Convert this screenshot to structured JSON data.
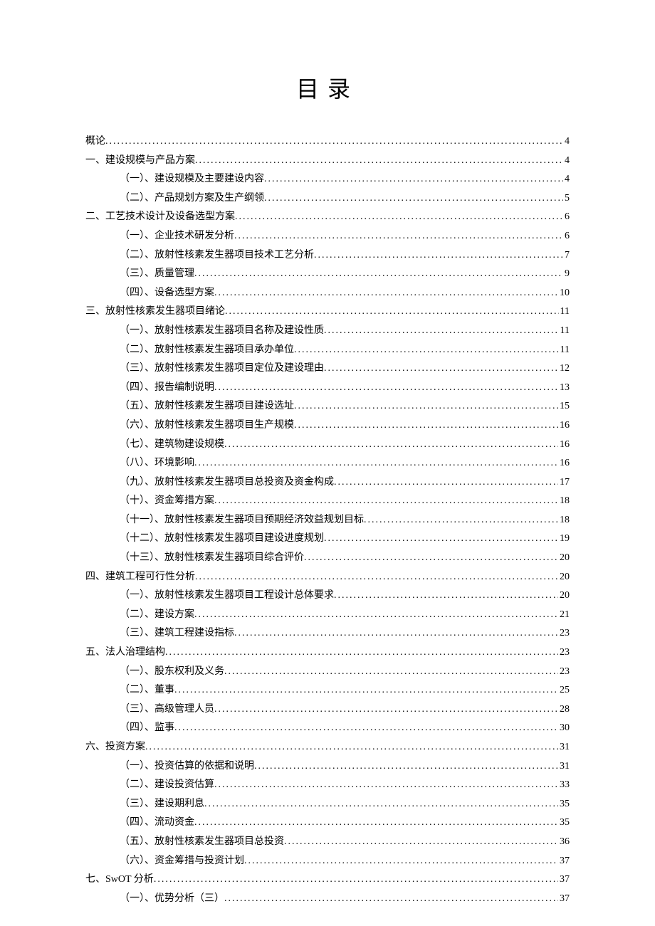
{
  "title": "目录",
  "toc": [
    {
      "level": 0,
      "label": "概论",
      "page": "4"
    },
    {
      "level": 0,
      "label": "一、建设规模与产品方案",
      "page": "4"
    },
    {
      "level": 1,
      "label": "（一）、建设规模及主要建设内容",
      "page": "4"
    },
    {
      "level": 1,
      "label": "（二）、产品规划方案及生产纲领",
      "page": "5"
    },
    {
      "level": 0,
      "label": "二、工艺技术设计及设备选型方案",
      "page": "6"
    },
    {
      "level": 1,
      "label": "（一）、企业技术研发分析",
      "page": "6"
    },
    {
      "level": 1,
      "label": "（二）、放射性核素发生器项目技术工艺分析",
      "page": "7"
    },
    {
      "level": 1,
      "label": "（三）、质量管理",
      "page": "9"
    },
    {
      "level": 1,
      "label": "（四）、设备选型方案",
      "page": "10"
    },
    {
      "level": 0,
      "label": "三、放射性核素发生器项目绪论",
      "page": "11"
    },
    {
      "level": 1,
      "label": "（一）、放射性核素发生器项目名称及建设性质",
      "page": "11"
    },
    {
      "level": 1,
      "label": "（二）、放射性核素发生器项目承办单位",
      "page": "11"
    },
    {
      "level": 1,
      "label": "（三）、放射性核素发生器项目定位及建设理由",
      "page": "12"
    },
    {
      "level": 1,
      "label": "（四）、报告编制说明",
      "page": "13"
    },
    {
      "level": 1,
      "label": "（五）、放射性核素发生器项目建设选址",
      "page": "15"
    },
    {
      "level": 1,
      "label": "（六）、放射性核素发生器项目生产规模",
      "page": "16"
    },
    {
      "level": 1,
      "label": "（七）、建筑物建设规模",
      "page": "16"
    },
    {
      "level": 1,
      "label": "（八）、环境影响",
      "page": "16"
    },
    {
      "level": 1,
      "label": "（九）、放射性核素发生器项目总投资及资金构成",
      "page": "17"
    },
    {
      "level": 1,
      "label": "（十）、资金筹措方案",
      "page": "18"
    },
    {
      "level": 1,
      "label": "（十一）、放射性核素发生器项目预期经济效益规划目标",
      "page": "18"
    },
    {
      "level": 1,
      "label": "（十二）、放射性核素发生器项目建设进度规划",
      "page": "19"
    },
    {
      "level": 1,
      "label": "（十三）、放射性核素发生器项目综合评价",
      "page": "20"
    },
    {
      "level": 0,
      "label": "四、建筑工程可行性分析",
      "page": "20"
    },
    {
      "level": 1,
      "label": "（一）、放射性核素发生器项目工程设计总体要求",
      "page": "20"
    },
    {
      "level": 1,
      "label": "（二）、建设方案",
      "page": "21"
    },
    {
      "level": 1,
      "label": "（三）、建筑工程建设指标",
      "page": "23"
    },
    {
      "level": 0,
      "label": "五、法人治理结构",
      "page": "23"
    },
    {
      "level": 1,
      "label": "（一）、股东权利及义务",
      "page": "23"
    },
    {
      "level": 1,
      "label": "（二）、董事",
      "page": "25"
    },
    {
      "level": 1,
      "label": "（三）、高级管理人员",
      "page": "28"
    },
    {
      "level": 1,
      "label": "（四）、监事",
      "page": "30"
    },
    {
      "level": 0,
      "label": "六、投资方案",
      "page": "31"
    },
    {
      "level": 1,
      "label": "（一）、投资估算的依据和说明",
      "page": "31"
    },
    {
      "level": 1,
      "label": "（二）、建设投资估算",
      "page": "33"
    },
    {
      "level": 1,
      "label": "（三）、建设期利息",
      "page": "35"
    },
    {
      "level": 1,
      "label": "（四）、流动资金",
      "page": "35"
    },
    {
      "level": 1,
      "label": "（五）、放射性核素发生器项目总投资",
      "page": "36"
    },
    {
      "level": 1,
      "label": "（六）、资金筹措与投资计划",
      "page": "37"
    },
    {
      "level": 0,
      "label": "七、SwOT 分析",
      "page": "37"
    },
    {
      "level": 1,
      "label": "（一）、优势分析（三）",
      "page": "37"
    }
  ]
}
